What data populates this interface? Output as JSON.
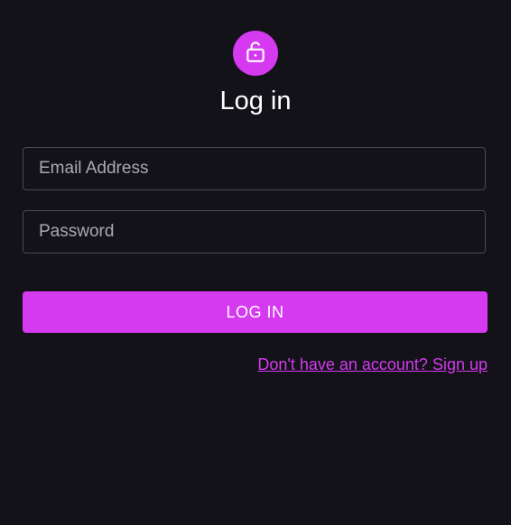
{
  "header": {
    "icon": "lock-open-icon",
    "title": "Log in"
  },
  "form": {
    "email": {
      "placeholder": "Email Address",
      "value": ""
    },
    "password": {
      "placeholder": "Password",
      "value": ""
    },
    "submit_label": "LOG IN",
    "signup_link": "Don't have an account? Sign up"
  },
  "colors": {
    "background": "#131219",
    "accent": "#d53af0",
    "border": "#4a4950",
    "text": "#ffffff",
    "placeholder": "#aaa9ae"
  }
}
